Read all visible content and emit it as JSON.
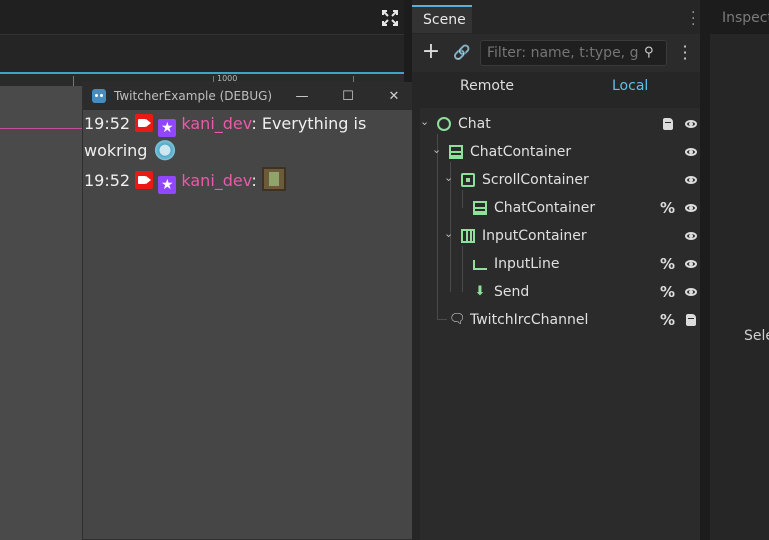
{
  "ruler": {
    "label": "1000"
  },
  "game_window": {
    "title": "TwitcherExample (DEBUG)",
    "controls": {
      "minimize": "—",
      "maximize": "☐",
      "close": "✕"
    },
    "messages": [
      {
        "time": "19:52",
        "user": "kani_dev",
        "separator": ":",
        "text": " Everything is wokring"
      },
      {
        "time": "19:52",
        "user": "kani_dev",
        "separator": ":",
        "text": ""
      }
    ]
  },
  "scene_dock": {
    "tab_label": "Scene",
    "filter_placeholder": "Filter: name, t:type, g:group",
    "remote_label": "Remote",
    "local_label": "Local",
    "active_view": "Local",
    "tree": [
      {
        "name": "Chat",
        "depth": 0,
        "icon": "node-circle-icon",
        "script": true,
        "visible": true
      },
      {
        "name": "ChatContainer",
        "depth": 1,
        "icon": "vbox-icon",
        "visible": true
      },
      {
        "name": "ScrollContainer",
        "depth": 2,
        "icon": "scroll-container-icon",
        "visible": true
      },
      {
        "name": "ChatContainer",
        "depth": 3,
        "icon": "vbox-icon",
        "anchored": true,
        "visible": true
      },
      {
        "name": "InputContainer",
        "depth": 2,
        "icon": "hbox-icon",
        "visible": true
      },
      {
        "name": "InputLine",
        "depth": 3,
        "icon": "line-edit-icon",
        "anchored": true,
        "visible": true
      },
      {
        "name": "Send",
        "depth": 3,
        "icon": "button-icon",
        "anchored": true,
        "visible": true
      },
      {
        "name": "TwitchIrcChannel",
        "depth": 1,
        "icon": "chat-node-icon",
        "anchored": true,
        "script": true
      }
    ]
  },
  "inspector": {
    "tab_label": "Inspector",
    "hint_text": "Select"
  },
  "colors": {
    "accent": "#5fc0e8",
    "username": "#e95aa8",
    "node_green": "#8fe09a",
    "broadcaster_badge": "#e91916",
    "sub_badge": "#9146ff"
  }
}
